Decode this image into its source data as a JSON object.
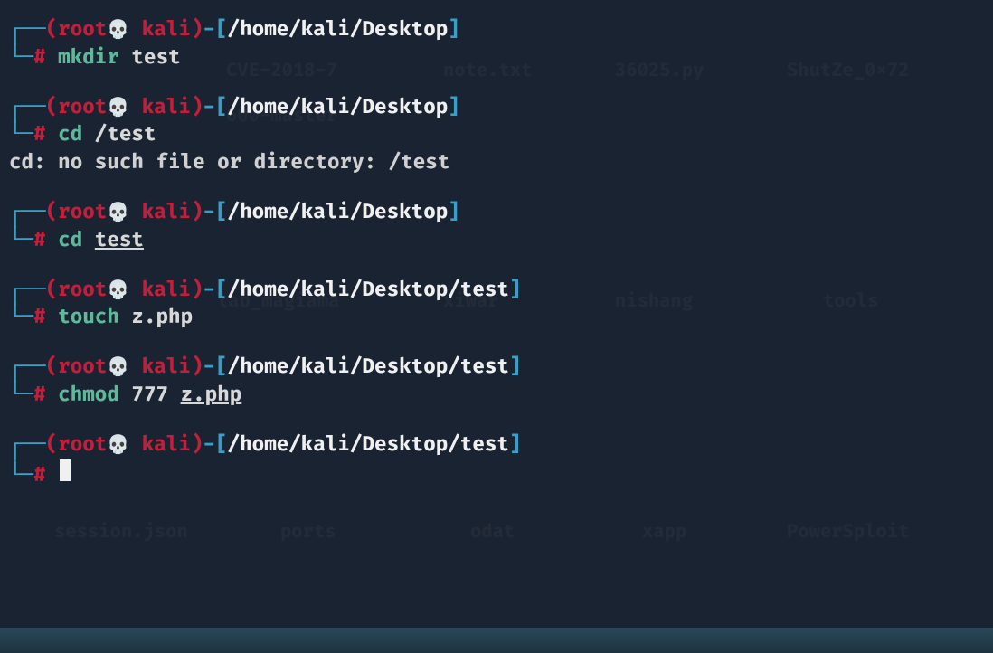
{
  "prompts": [
    {
      "user": "root",
      "host": " kali",
      "path": "/home/kali/Desktop",
      "cmd": "mkdir",
      "args": "test",
      "args_underline": false,
      "output": ""
    },
    {
      "user": "root",
      "host": " kali",
      "path": "/home/kali/Desktop",
      "cmd": "cd",
      "args": "/test",
      "args_underline": false,
      "output": "cd: no such file or directory: /test"
    },
    {
      "user": "root",
      "host": " kali",
      "path": "/home/kali/Desktop",
      "cmd": "cd",
      "args": "test",
      "args_underline": true,
      "output": ""
    },
    {
      "user": "root",
      "host": " kali",
      "path": "/home/kali/Desktop/test",
      "cmd": "touch",
      "args": "z.php",
      "args_underline": false,
      "output": ""
    },
    {
      "user": "root",
      "host": " kali",
      "path": "/home/kali/Desktop/test",
      "cmd": "chmod",
      "args_pre": "777 ",
      "args": "z.php",
      "args_underline": true,
      "output": ""
    },
    {
      "user": "root",
      "host": " kali",
      "path": "/home/kali/Desktop/test",
      "cmd": "",
      "args": "",
      "args_underline": false,
      "output": "",
      "cursor": true
    }
  ],
  "box_chars": {
    "tl": "┌──",
    "bl": "└─"
  },
  "skull": "💀",
  "hash": "#",
  "desktop_labels": {
    "cve": "CVE-2018-7",
    "note": "note.txt",
    "py": "36025.py",
    "shut": "ShutZe_0x72",
    "six": "600-master",
    "lab": "lab_magiama",
    "xwar": "xiwar",
    "nishang": "nishang",
    "tools": "tools",
    "session": "session.json",
    "ports": "ports",
    "odat": "odat",
    "xapp": "xapp",
    "power": "PowerSploit"
  }
}
